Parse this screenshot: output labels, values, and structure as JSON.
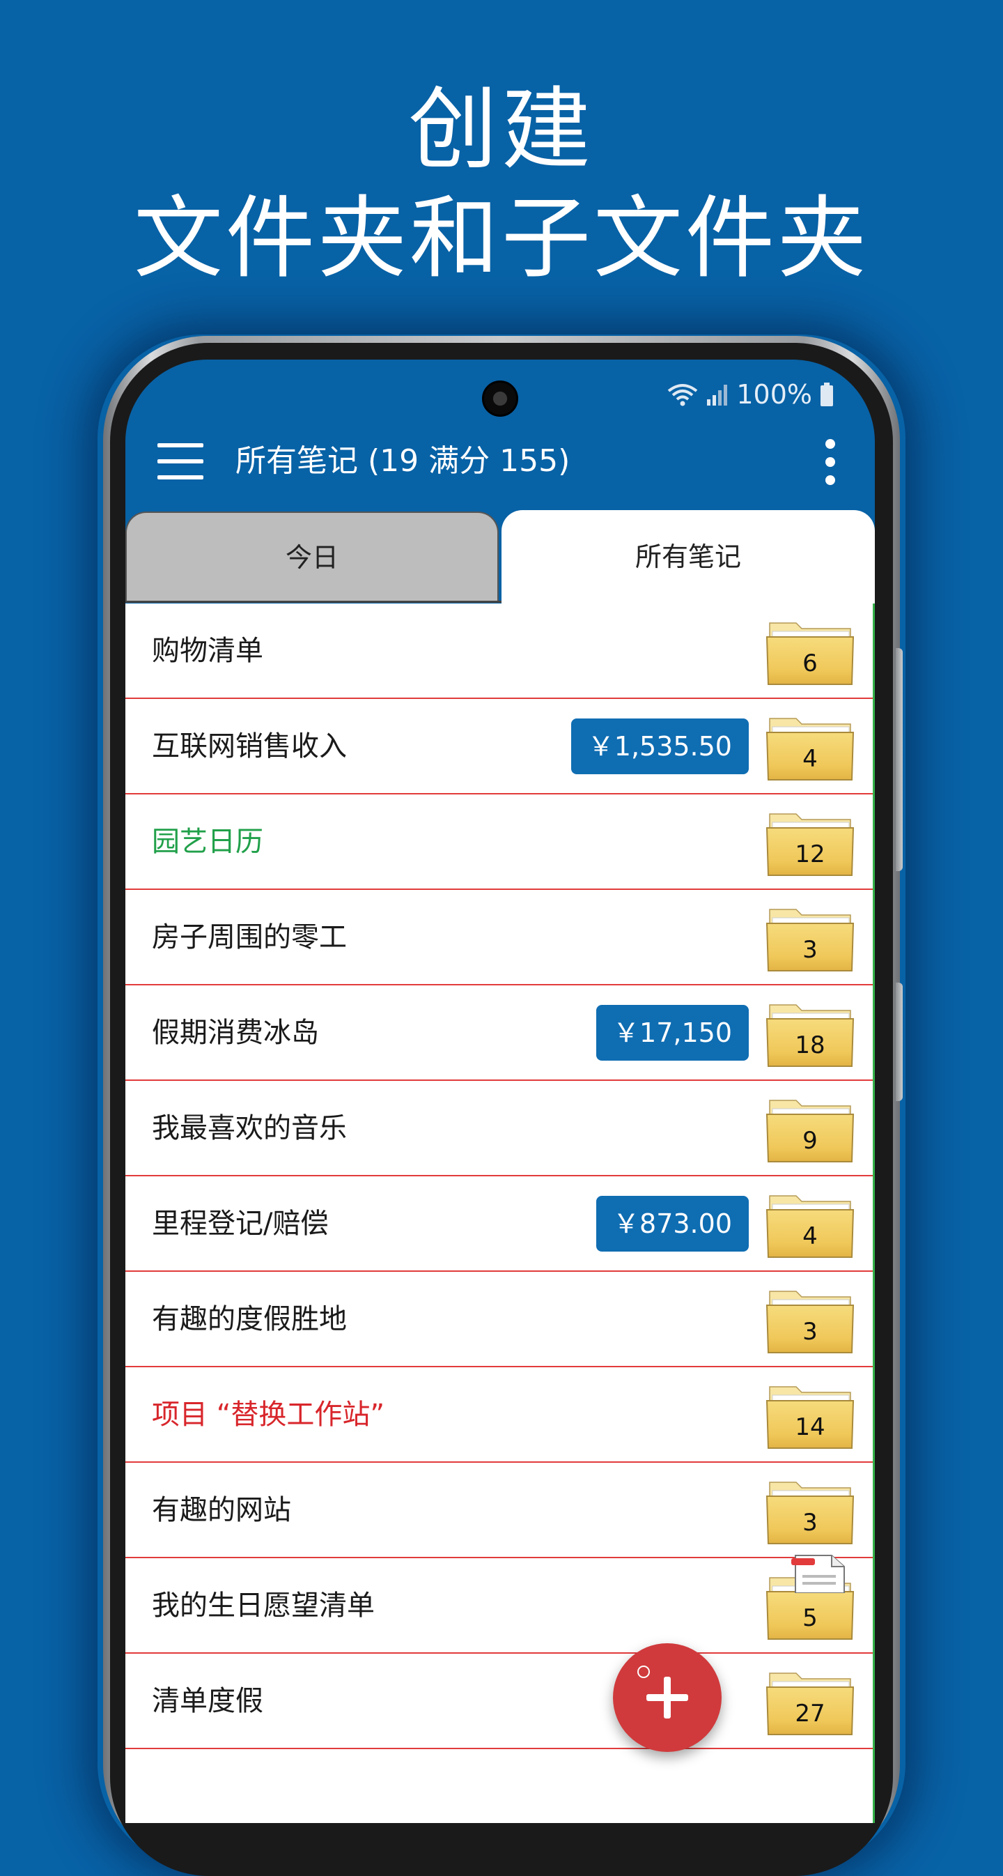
{
  "headline": {
    "line1": "创建",
    "line2": "文件夹和子文件夹"
  },
  "status_bar": {
    "battery": "100%"
  },
  "app_bar": {
    "title": "所有笔记 (19 满分 155)"
  },
  "tabs": {
    "today": "今日",
    "all_notes": "所有笔记",
    "active": "all_notes"
  },
  "notes": [
    {
      "label": "购物清单",
      "count": "6",
      "color": "#1a1a1a",
      "amount": ""
    },
    {
      "label": "互联网销售收入",
      "count": "4",
      "color": "#1a1a1a",
      "amount": "￥1,535.50"
    },
    {
      "label": "园艺日历",
      "count": "12",
      "color": "#21a04a",
      "amount": ""
    },
    {
      "label": "房子周围的零工",
      "count": "3",
      "color": "#1a1a1a",
      "amount": ""
    },
    {
      "label": "假期消费冰岛",
      "count": "18",
      "color": "#1a1a1a",
      "amount": "￥17,150"
    },
    {
      "label": "我最喜欢的音乐",
      "count": "9",
      "color": "#1a1a1a",
      "amount": ""
    },
    {
      "label": "里程登记/赔偿",
      "count": "4",
      "color": "#1a1a1a",
      "amount": "￥873.00"
    },
    {
      "label": "有趣的度假胜地",
      "count": "3",
      "color": "#1a1a1a",
      "amount": ""
    },
    {
      "label": "项目 “替换工作站”",
      "count": "14",
      "color": "#d8262b",
      "amount": ""
    },
    {
      "label": "有趣的网站",
      "count": "3",
      "color": "#1a1a1a",
      "amount": ""
    },
    {
      "label": "我的生日愿望清单",
      "count": "5",
      "color": "#1a1a1a",
      "amount": ""
    },
    {
      "label": "清单度假",
      "count": "27",
      "color": "#1a1a1a",
      "amount": ""
    }
  ],
  "colors": {
    "background": "#0862a6",
    "app_bar": "#0862a6",
    "amount_badge": "#0f6db2",
    "divider": "#e23b3b",
    "fab": "#d03a3c",
    "folder": "#f2cd5c"
  },
  "icons": {
    "menu": "hamburger-menu-icon",
    "more": "more-vertical-icon",
    "folder": "folder-icon",
    "fab": "plus-icon"
  }
}
